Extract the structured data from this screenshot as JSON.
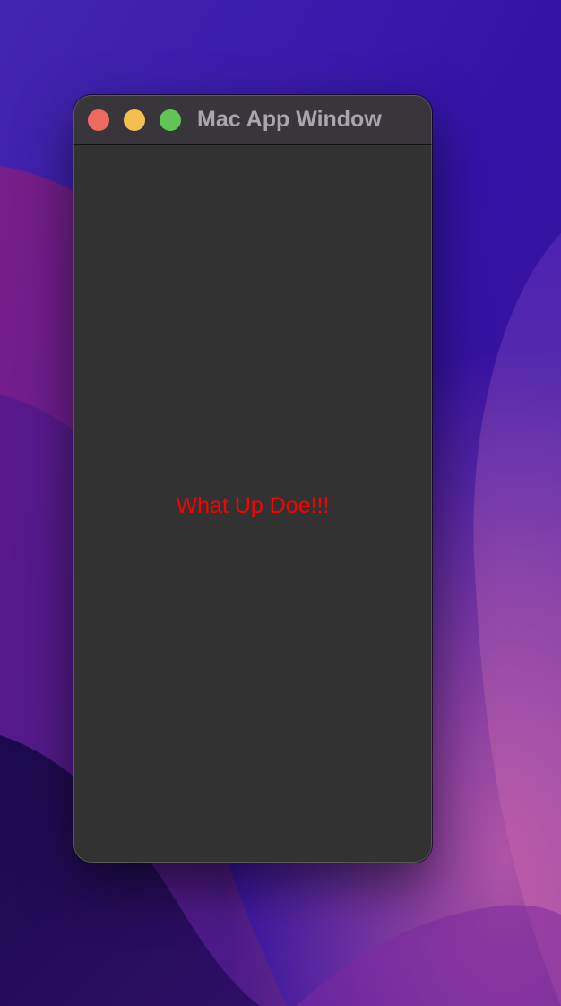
{
  "desktop": {
    "wallpaper_name": "purple-wave-wallpaper"
  },
  "window": {
    "title": "Mac App Window",
    "content_text": "What Up Doe!!!",
    "content_text_color": "#ff0000",
    "traffic_lights": [
      {
        "name": "close",
        "color": "#ee6a5f"
      },
      {
        "name": "minimize",
        "color": "#f5bf4f"
      },
      {
        "name": "zoom",
        "color": "#61c554"
      }
    ]
  }
}
